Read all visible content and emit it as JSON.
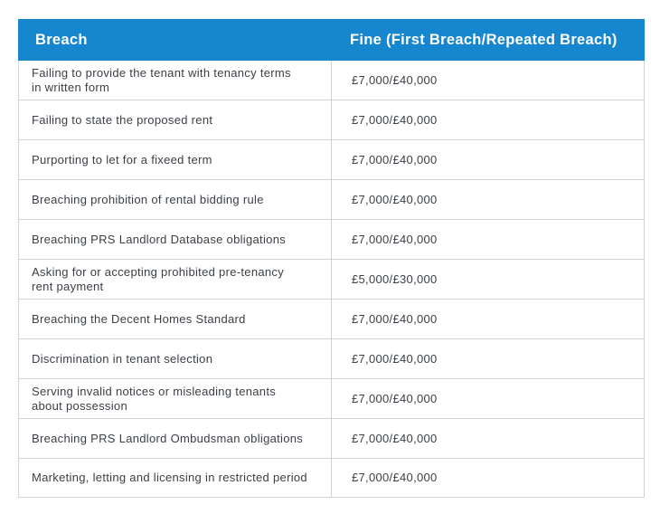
{
  "table": {
    "headers": [
      "Breach",
      "Fine (First Breach/Repeated Breach)"
    ],
    "rows": [
      {
        "breach": "Failing to provide the tenant with tenancy terms in written form",
        "fine": "£7,000/£40,000"
      },
      {
        "breach": "Failing to state the proposed rent",
        "fine": "£7,000/£40,000"
      },
      {
        "breach": "Purporting to let for a fixeed term",
        "fine": "£7,000/£40,000"
      },
      {
        "breach": "Breaching prohibition of rental bidding rule",
        "fine": "£7,000/£40,000"
      },
      {
        "breach": "Breaching PRS Landlord Database obligations",
        "fine": "£7,000/£40,000"
      },
      {
        "breach": "Asking for or accepting prohibited pre-tenancy rent payment",
        "fine": "£5,000/£30,000"
      },
      {
        "breach": "Breaching the Decent Homes Standard",
        "fine": "£7,000/£40,000"
      },
      {
        "breach": "Discrimination in tenant selection",
        "fine": "£7,000/£40,000"
      },
      {
        "breach": "Serving invalid notices or misleading tenants about possession",
        "fine": "£7,000/£40,000"
      },
      {
        "breach": "Breaching PRS Landlord Ombudsman obligations",
        "fine": "£7,000/£40,000"
      },
      {
        "breach": "Marketing, letting and licensing in restricted period",
        "fine": "£7,000/£40,000"
      }
    ]
  },
  "colors": {
    "header_bg": "#1686cf",
    "header_text": "#ffffff",
    "border": "#cfd4d8",
    "body_text": "#3b4046"
  }
}
